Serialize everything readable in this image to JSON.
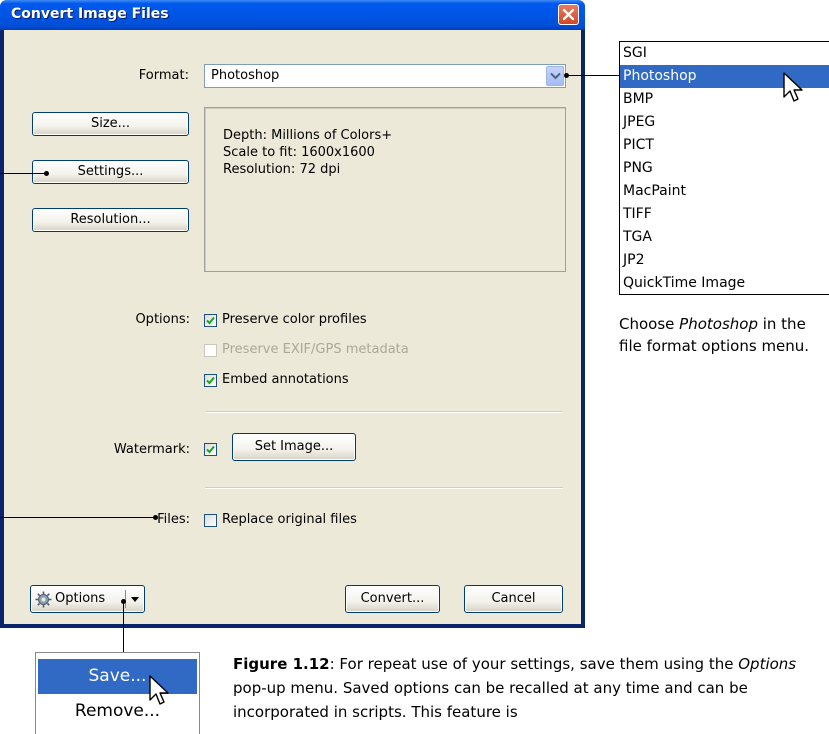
{
  "window": {
    "title": "Convert Image Files"
  },
  "format": {
    "label": "Format:",
    "value": "Photoshop"
  },
  "buttons": {
    "size": "Size...",
    "settings": "Settings...",
    "resolution": "Resolution...",
    "set_image": "Set Image...",
    "options": "Options",
    "convert": "Convert...",
    "cancel": "Cancel"
  },
  "info": {
    "depth": "Depth: Millions of Colors+",
    "scale": "Scale to fit: 1600x1600",
    "resolution": "Resolution: 72 dpi"
  },
  "options": {
    "label": "Options:",
    "preserve_color_profiles": {
      "label": "Preserve color profiles",
      "checked": true,
      "enabled": true
    },
    "preserve_exif": {
      "label": "Preserve EXIF/GPS metadata",
      "checked": false,
      "enabled": false
    },
    "embed_annotations": {
      "label": "Embed annotations",
      "checked": true,
      "enabled": true
    }
  },
  "watermark": {
    "label": "Watermark:",
    "checked": true
  },
  "files": {
    "label": "Files:",
    "replace_label": "Replace original files",
    "checked": false
  },
  "format_menu": {
    "items": [
      "SGI",
      "Photoshop",
      "BMP",
      "JPEG",
      "PICT",
      "PNG",
      "MacPaint",
      "TIFF",
      "TGA",
      "JP2",
      "QuickTime Image"
    ],
    "selected": "Photoshop"
  },
  "caption": {
    "before": "Choose ",
    "emph": "Photoshop",
    "after": " in the file format options menu."
  },
  "options_menu": {
    "items": [
      "Save...",
      "Remove..."
    ],
    "selected": "Save..."
  },
  "figure_caption": {
    "label": "Figure 1.12",
    "part1": ": For repeat use of your settings, save them using the ",
    "emph": "Options",
    "part2": " pop-up menu. Saved options can be recalled at any time and can be incorporated in scripts. This feature is"
  },
  "colors": {
    "titlebar": "#0055e5",
    "dialog_bg": "#ece9d8",
    "selection": "#316ac5",
    "close_button": "#d24726"
  }
}
